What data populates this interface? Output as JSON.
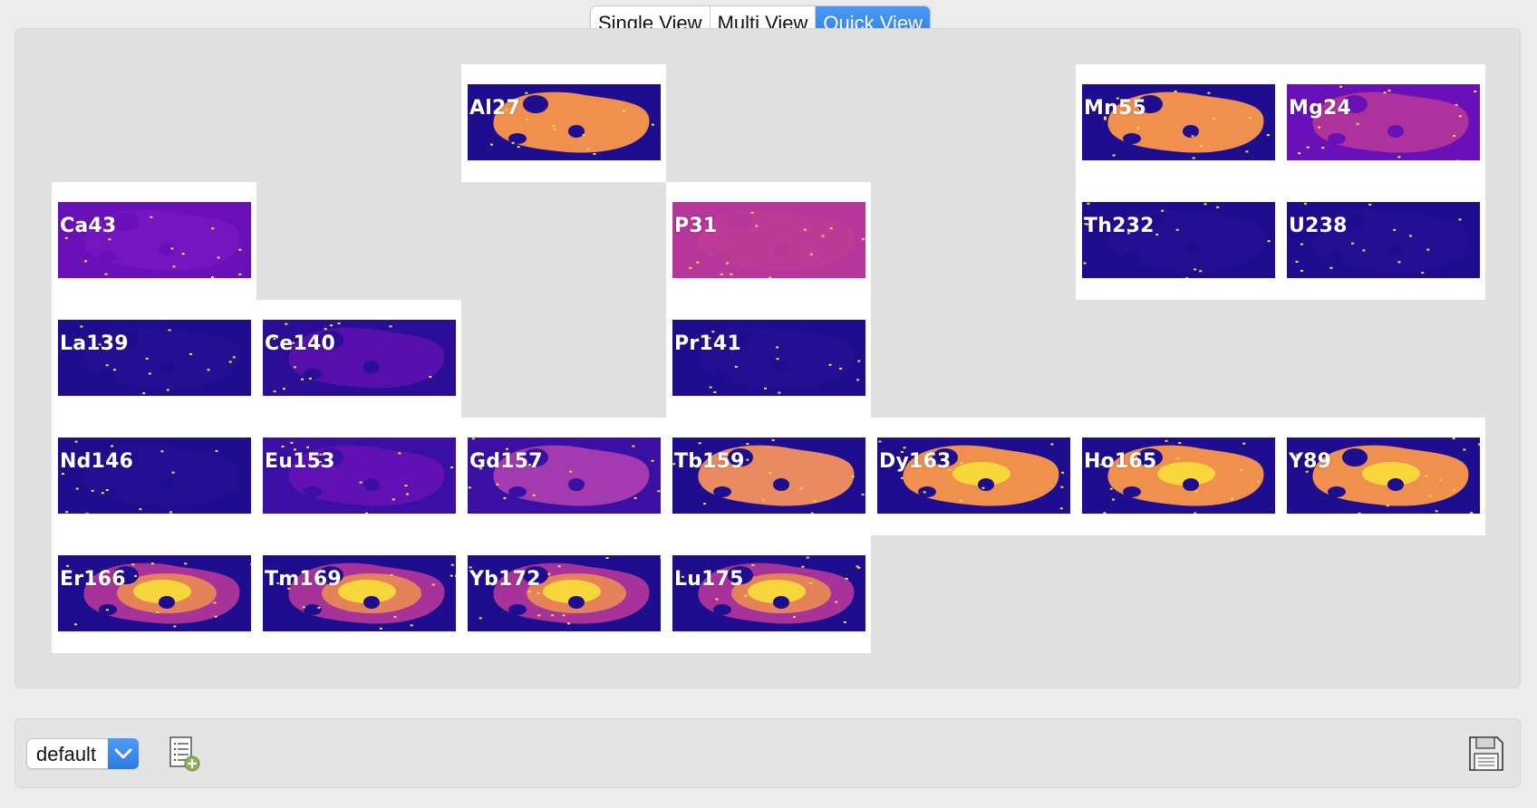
{
  "view_modes": {
    "options": [
      "Single View",
      "Multi View",
      "Quick View"
    ],
    "selected": "Quick View"
  },
  "elements": [
    {
      "label": "Al27",
      "col": 2,
      "row": 0,
      "scheme": "al"
    },
    {
      "label": "Mn55",
      "col": 5,
      "row": 0,
      "scheme": "mn"
    },
    {
      "label": "Mg24",
      "col": 6,
      "row": 0,
      "scheme": "mg"
    },
    {
      "label": "Ca43",
      "col": 0,
      "row": 1,
      "scheme": "ca"
    },
    {
      "label": "P31",
      "col": 3,
      "row": 1,
      "scheme": "p"
    },
    {
      "label": "Th232",
      "col": 5,
      "row": 1,
      "scheme": "dark"
    },
    {
      "label": "U238",
      "col": 6,
      "row": 1,
      "scheme": "dark"
    },
    {
      "label": "La139",
      "col": 0,
      "row": 2,
      "scheme": "dark"
    },
    {
      "label": "Ce140",
      "col": 1,
      "row": 2,
      "scheme": "ce"
    },
    {
      "label": "Pr141",
      "col": 3,
      "row": 2,
      "scheme": "dark"
    },
    {
      "label": "Nd146",
      "col": 0,
      "row": 3,
      "scheme": "dark"
    },
    {
      "label": "Eu153",
      "col": 1,
      "row": 3,
      "scheme": "eu"
    },
    {
      "label": "Gd157",
      "col": 2,
      "row": 3,
      "scheme": "gd"
    },
    {
      "label": "Tb159",
      "col": 3,
      "row": 3,
      "scheme": "tb"
    },
    {
      "label": "Dy163",
      "col": 4,
      "row": 3,
      "scheme": "dy"
    },
    {
      "label": "Ho165",
      "col": 5,
      "row": 3,
      "scheme": "ho"
    },
    {
      "label": "Y89",
      "col": 6,
      "row": 3,
      "scheme": "ho"
    },
    {
      "label": "Er166",
      "col": 0,
      "row": 4,
      "scheme": "er"
    },
    {
      "label": "Tm169",
      "col": 1,
      "row": 4,
      "scheme": "er"
    },
    {
      "label": "Yb172",
      "col": 2,
      "row": 4,
      "scheme": "er"
    },
    {
      "label": "Lu175",
      "col": 3,
      "row": 4,
      "scheme": "er"
    }
  ],
  "colormap": {
    "dark_blue": "#1f0d8f",
    "purple": "#6a10b8",
    "magenta": "#b6369a",
    "orange": "#f0904e",
    "yellow": "#f8df3a"
  },
  "bottom": {
    "preset_value": "default",
    "add_list_icon": "list-add-icon",
    "save_icon": "floppy-disk-icon"
  }
}
